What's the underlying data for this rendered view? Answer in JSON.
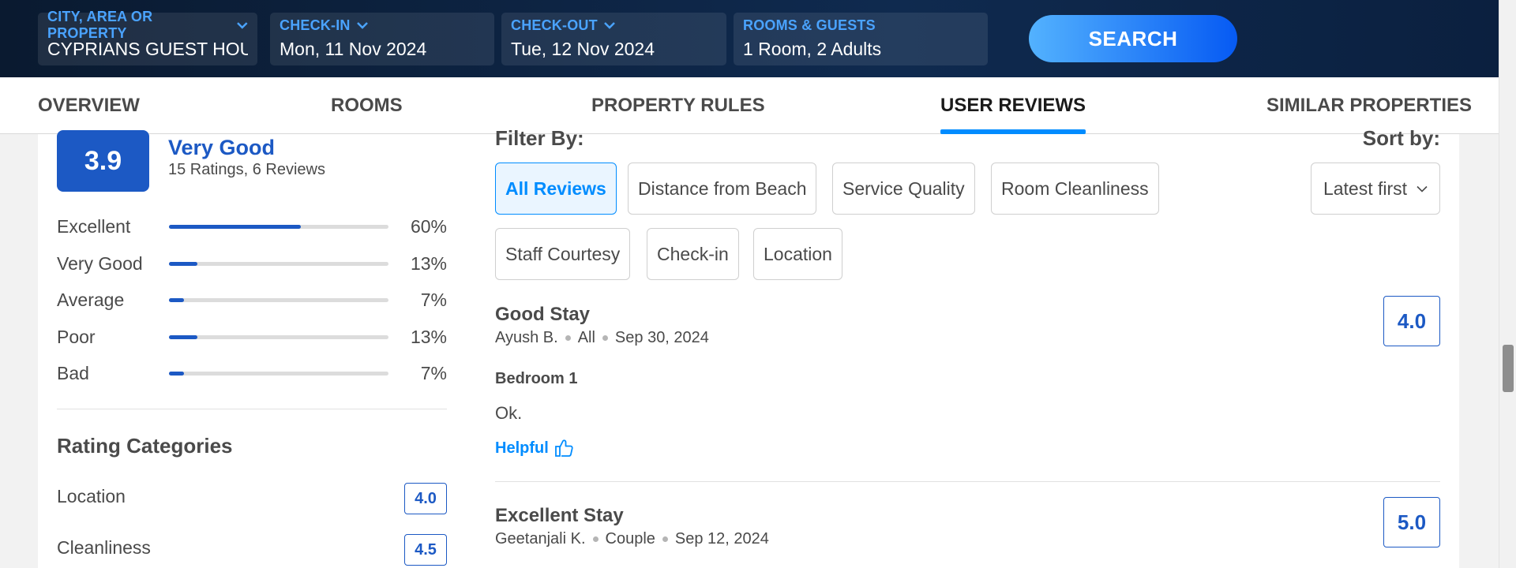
{
  "search": {
    "location_label": "CITY, AREA OR PROPERTY",
    "location_value": "CYPRIANS GUEST HOUSE",
    "checkin_label": "CHECK-IN",
    "checkin_value": "Mon, 11 Nov 2024",
    "checkout_label": "CHECK-OUT",
    "checkout_value": "Tue, 12 Nov 2024",
    "guests_label": "ROOMS & GUESTS",
    "guests_value": "1 Room, 2 Adults",
    "button_label": "SEARCH"
  },
  "tabs": [
    {
      "label": "OVERVIEW",
      "active": false
    },
    {
      "label": "ROOMS",
      "active": false
    },
    {
      "label": "PROPERTY RULES",
      "active": false
    },
    {
      "label": "USER REVIEWS",
      "active": true
    },
    {
      "label": "SIMILAR PROPERTIES",
      "active": false
    }
  ],
  "summary": {
    "score": "3.9",
    "label": "Very Good",
    "counts": "15 Ratings, 6 Reviews"
  },
  "distribution": [
    {
      "name": "Excellent",
      "percent": 60,
      "text": "60%"
    },
    {
      "name": "Very Good",
      "percent": 13,
      "text": "13%"
    },
    {
      "name": "Average",
      "percent": 7,
      "text": "7%"
    },
    {
      "name": "Poor",
      "percent": 13,
      "text": "13%"
    },
    {
      "name": "Bad",
      "percent": 7,
      "text": "7%"
    }
  ],
  "rating_categories": {
    "title": "Rating Categories",
    "items": [
      {
        "name": "Location",
        "score": "4.0"
      },
      {
        "name": "Cleanliness",
        "score": "4.5"
      }
    ]
  },
  "filters": {
    "title": "Filter By:",
    "chips": [
      {
        "label": "All Reviews",
        "active": true
      },
      {
        "label": "Distance from Beach",
        "active": false
      },
      {
        "label": "Service Quality",
        "active": false
      },
      {
        "label": "Room Cleanliness",
        "active": false
      },
      {
        "label": "Staff Courtesy",
        "active": false
      },
      {
        "label": "Check-in",
        "active": false
      },
      {
        "label": "Location",
        "active": false
      }
    ]
  },
  "sort": {
    "title": "Sort by:",
    "selected": "Latest first"
  },
  "reviews": [
    {
      "title": "Good Stay",
      "author": "Ayush B.",
      "traveller_type": "All",
      "date": "Sep 30, 2024",
      "score": "4.0",
      "room": "Bedroom 1",
      "text": "Ok.",
      "helpful_label": "Helpful"
    },
    {
      "title": "Excellent Stay",
      "author": "Geetanjali K.",
      "traveller_type": "Couple",
      "date": "Sep 12, 2024",
      "score": "5.0"
    }
  ],
  "colors": {
    "brand_blue": "#1c59c4",
    "accent_blue": "#008cff",
    "header_bg": "#0f2a4f"
  },
  "icons": [
    "chevron-down-icon",
    "thumbs-up-icon"
  ]
}
